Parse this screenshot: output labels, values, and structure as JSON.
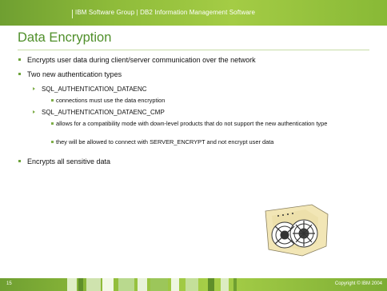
{
  "header": {
    "text": "IBM Software Group  |  DB2 Information Management Software"
  },
  "slide": {
    "title": "Data Encryption",
    "bullets": [
      "Encrypts user data during client/server communication over the network",
      "Two new authentication types",
      "Encrypts all sensitive data"
    ],
    "sub_bullets": [
      "SQL_AUTHENTICATION_DATAENC",
      "SQL_AUTHENTICATION_DATAENC_CMP"
    ],
    "sub_sub_bullets": [
      "connections must use the data encryption",
      "allows for a compatibility mode with down-level products that do not support the new authentication type",
      "they will be allowed to connect with SERVER_ENCRYPT and not encrypt user data"
    ]
  },
  "footer": {
    "slide_number": "15",
    "copyright": "Copyright © IBM 2004"
  },
  "colors": {
    "brand_green": "#8fbc3a",
    "title_green": "#4f8f2a",
    "bullet_green": "#6ea33c"
  }
}
